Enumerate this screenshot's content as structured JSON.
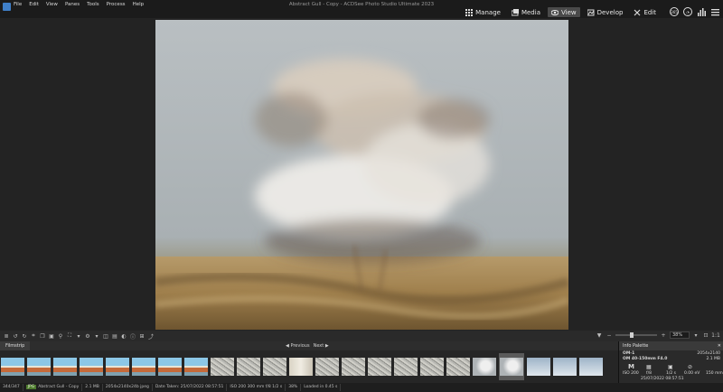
{
  "app": {
    "window_title": "Abstract Gull - Copy - ACDSee Photo Studio Ultimate 2023",
    "menu": [
      "File",
      "Edit",
      "View",
      "Panes",
      "Tools",
      "Process",
      "Help"
    ]
  },
  "modes": [
    {
      "label": "Manage",
      "icon": "grid-icon",
      "active": false
    },
    {
      "label": "Media",
      "icon": "media-icon",
      "active": false
    },
    {
      "label": "View",
      "icon": "eye-icon",
      "active": true
    },
    {
      "label": "Develop",
      "icon": "develop-icon",
      "active": false
    },
    {
      "label": "Edit",
      "icon": "edit-icon",
      "active": false
    }
  ],
  "top_icons": [
    "365-icon",
    "dashboard-icon",
    "stats-icon",
    "menu-icon"
  ],
  "toolbar": {
    "zoom_value": "38%",
    "zoom_level": 0.38
  },
  "filmstrip": {
    "title": "Filmstrip",
    "previous": "Previous",
    "next": "Next",
    "thumbnails": [
      "blue",
      "blue",
      "blue",
      "blue",
      "blue",
      "blue",
      "blue",
      "blue",
      "gray",
      "gray",
      "gray",
      "cream",
      "gray",
      "gray",
      "gray",
      "gray",
      "gray",
      "gray",
      "photo",
      "photo-selected",
      "sky",
      "sky",
      "sky"
    ]
  },
  "info_palette": {
    "title": "Info Palette",
    "camera": "OM-1",
    "lens": "OM 40-150mm F4.0",
    "dimensions": "2054x2140",
    "filesize": "2.1 MB",
    "mode": "M",
    "iso": "ISO 200",
    "aperture": "f/8",
    "shutter": "1/2 s",
    "exposure": "0.00 eV",
    "focal": "150 mm",
    "date": "25/07/2022 08:57:51"
  },
  "status": {
    "count": "344/347",
    "format": "JPG",
    "filename": "Abstract Gull - Copy",
    "size": "2.1 MB",
    "dims": "2054x2140x24b jpeg",
    "date_taken": "Date Taken: 25/07/2022 08:57:51",
    "exif": "ISO 200   300 mm   f/8   1/2 s",
    "zoom": "38%",
    "loaded": "Loaded in 0.45 s"
  }
}
